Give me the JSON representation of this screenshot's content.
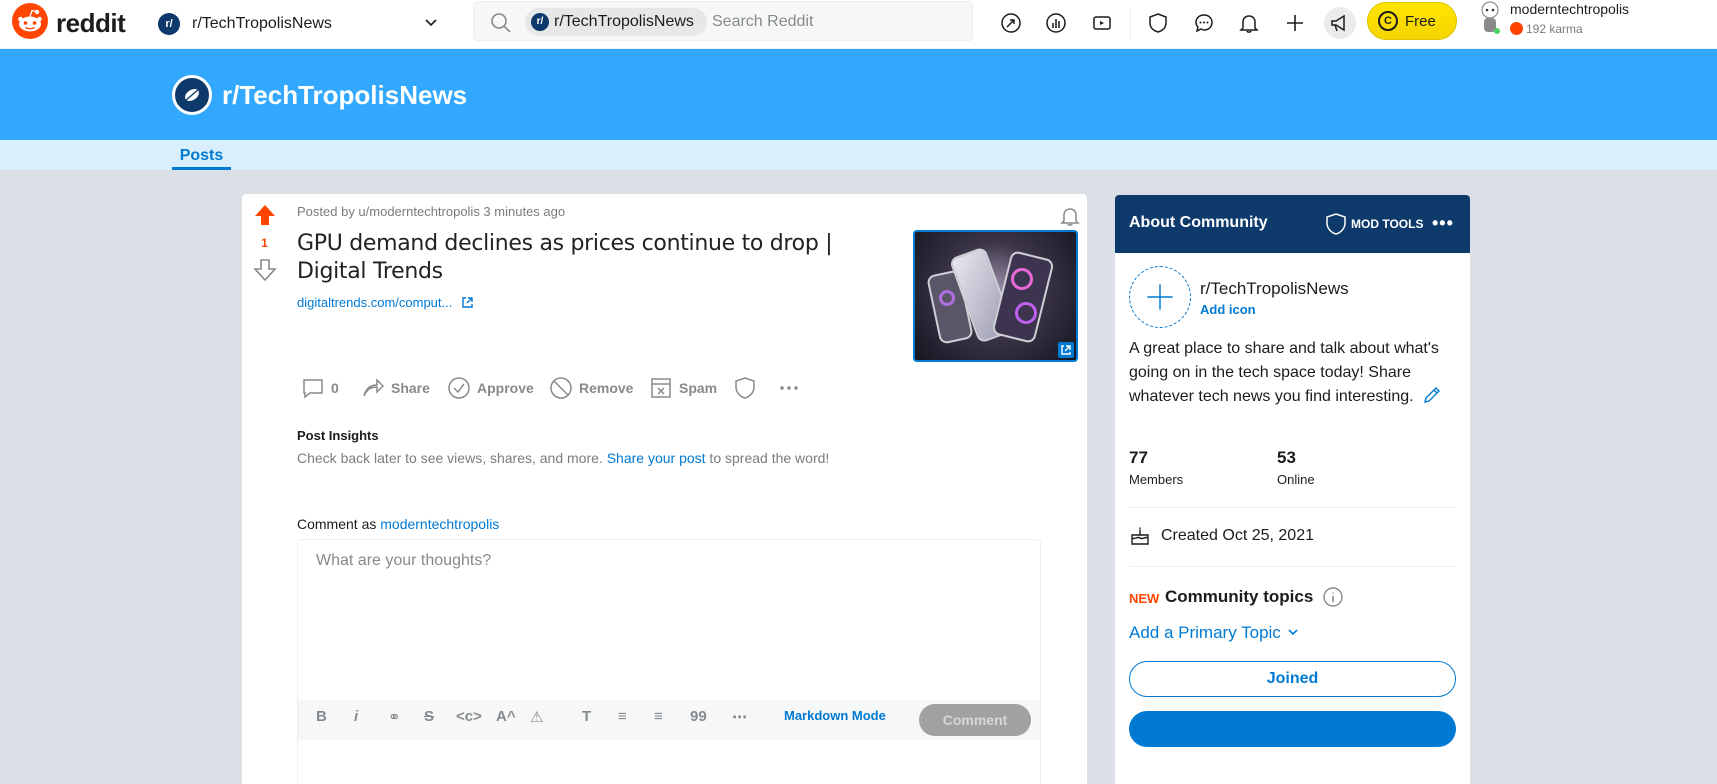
{
  "header": {
    "logo_text": "reddit",
    "community": "r/TechTropolisNews",
    "search_chip": "r/TechTropolisNews",
    "search_placeholder": "Search Reddit",
    "free_label": "Free",
    "user_name": "moderntechtropolis",
    "user_karma": "192 karma",
    "icons": [
      "popular-icon",
      "stats-icon",
      "video-icon",
      "mod-shield-icon",
      "chat-icon",
      "notification-icon",
      "create-post-icon",
      "advertise-icon"
    ]
  },
  "banner": {
    "title": "r/TechTropolisNews",
    "tab_posts": "Posts"
  },
  "post": {
    "vote_count": "1",
    "meta": "Posted by u/moderntechtropolis 3 minutes ago",
    "title": "GPU demand declines as prices continue to drop | Digital Trends",
    "link": "digitaltrends.com/comput...",
    "actions": {
      "comments": "0",
      "share": "Share",
      "approve": "Approve",
      "remove": "Remove",
      "spam": "Spam"
    },
    "insights_title": "Post Insights",
    "insights_pre": "Check back later to see views, shares, and more. ",
    "insights_link": "Share your post",
    "insights_post": " to spread the word!",
    "comment_as_label": "Comment as ",
    "comment_as_user": "moderntechtropolis",
    "comment_placeholder": "What are your thoughts?",
    "markdown_mode": "Markdown Mode",
    "comment_button": "Comment"
  },
  "about": {
    "title": "About Community",
    "mod_tools": "MOD TOOLS",
    "name": "r/TechTropolisNews",
    "add_icon": "Add icon",
    "description": "A great place to share and talk about what's going on in the tech space today! Share whatever tech news you find interesting.",
    "members_count": "77",
    "members_label": "Members",
    "online_count": "53",
    "online_label": "Online",
    "created": "Created Oct 25, 2021",
    "new_tag": "NEW",
    "topics_label": "Community topics",
    "primary_topic": "Add a Primary Topic",
    "joined_button": "Joined"
  },
  "colors": {
    "brand": "#ff4500",
    "banner": "#33a8ff",
    "about_header": "#0e3a6b",
    "link": "#0079d3"
  }
}
